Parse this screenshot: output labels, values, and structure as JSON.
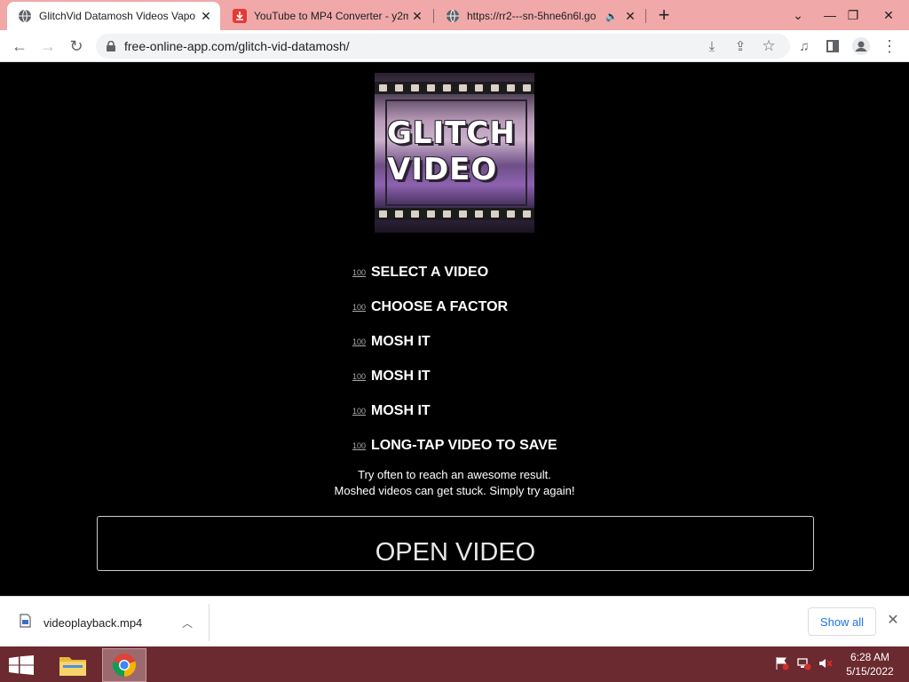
{
  "browser": {
    "tabs": [
      {
        "title": "GlitchVid Datamosh Videos Vapo",
        "active": true
      },
      {
        "title": "YouTube to MP4 Converter - y2m",
        "active": false
      },
      {
        "title": "https://rr2---sn-5hne6n6l.go",
        "active": false
      }
    ],
    "url": "free-online-app.com/glitch-vid-datamosh/"
  },
  "page": {
    "logo": {
      "line1": "GLITCH",
      "line2": "VIDEO"
    },
    "steps": [
      {
        "num": "100",
        "label": "SELECT A VIDEO"
      },
      {
        "num": "100",
        "label": "CHOOSE A FACTOR"
      },
      {
        "num": "100",
        "label": "MOSH IT"
      },
      {
        "num": "100",
        "label": "MOSH IT"
      },
      {
        "num": "100",
        "label": "MOSH IT"
      },
      {
        "num": "100",
        "label": "LONG-TAP VIDEO TO SAVE"
      }
    ],
    "hint_line1": "Try often to reach an awesome result.",
    "hint_line2": "Moshed videos can get stuck. Simply try again!",
    "open_button": "OPEN VIDEO"
  },
  "downloads": {
    "filename": "videoplayback.mp4",
    "show_all": "Show all"
  },
  "taskbar": {
    "time": "6:28 AM",
    "date": "5/15/2022"
  },
  "colors": {
    "tabstrip": "#f0a8a8",
    "taskbar": "#6b2a2f",
    "link": "#1a73e8"
  }
}
